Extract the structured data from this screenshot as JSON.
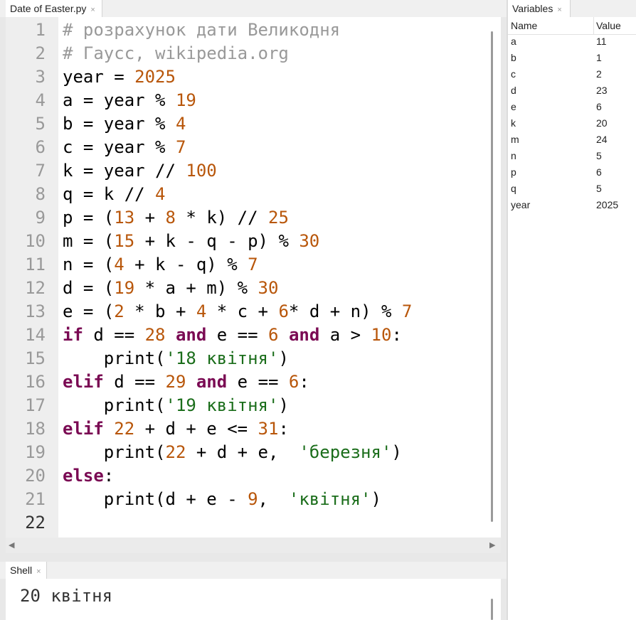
{
  "editor": {
    "tab_label": "Date of Easter.py",
    "tab_close": "×",
    "line_numbers": [
      "1",
      "2",
      "3",
      "4",
      "5",
      "6",
      "7",
      "8",
      "9",
      "10",
      "11",
      "12",
      "13",
      "14",
      "15",
      "16",
      "17",
      "18",
      "19",
      "20",
      "21",
      "22"
    ],
    "lines": [
      [
        {
          "t": "# розрахунок дати Великодня",
          "c": "cm"
        }
      ],
      [
        {
          "t": "# Гаусс, wikipedia.org",
          "c": "cm"
        }
      ],
      [
        {
          "t": "year = ",
          "c": ""
        },
        {
          "t": "2025",
          "c": "nm"
        }
      ],
      [
        {
          "t": "a = year % ",
          "c": ""
        },
        {
          "t": "19",
          "c": "nm"
        }
      ],
      [
        {
          "t": "b = year % ",
          "c": ""
        },
        {
          "t": "4",
          "c": "nm"
        }
      ],
      [
        {
          "t": "c = year % ",
          "c": ""
        },
        {
          "t": "7",
          "c": "nm"
        }
      ],
      [
        {
          "t": "k = year // ",
          "c": ""
        },
        {
          "t": "100",
          "c": "nm"
        }
      ],
      [
        {
          "t": "q = k // ",
          "c": ""
        },
        {
          "t": "4",
          "c": "nm"
        }
      ],
      [
        {
          "t": "p = (",
          "c": ""
        },
        {
          "t": "13",
          "c": "nm"
        },
        {
          "t": " + ",
          "c": ""
        },
        {
          "t": "8",
          "c": "nm"
        },
        {
          "t": " * k) // ",
          "c": ""
        },
        {
          "t": "25",
          "c": "nm"
        }
      ],
      [
        {
          "t": "m = (",
          "c": ""
        },
        {
          "t": "15",
          "c": "nm"
        },
        {
          "t": " + k - q - p) % ",
          "c": ""
        },
        {
          "t": "30",
          "c": "nm"
        }
      ],
      [
        {
          "t": "n = (",
          "c": ""
        },
        {
          "t": "4",
          "c": "nm"
        },
        {
          "t": " + k - q) % ",
          "c": ""
        },
        {
          "t": "7",
          "c": "nm"
        }
      ],
      [
        {
          "t": "d = (",
          "c": ""
        },
        {
          "t": "19",
          "c": "nm"
        },
        {
          "t": " * a + m) % ",
          "c": ""
        },
        {
          "t": "30",
          "c": "nm"
        }
      ],
      [
        {
          "t": "e = (",
          "c": ""
        },
        {
          "t": "2",
          "c": "nm"
        },
        {
          "t": " * b + ",
          "c": ""
        },
        {
          "t": "4",
          "c": "nm"
        },
        {
          "t": " * c + ",
          "c": ""
        },
        {
          "t": "6",
          "c": "nm"
        },
        {
          "t": "* d + n) % ",
          "c": ""
        },
        {
          "t": "7",
          "c": "nm"
        }
      ],
      [
        {
          "t": "if",
          "c": "kw"
        },
        {
          "t": " d == ",
          "c": ""
        },
        {
          "t": "28",
          "c": "nm"
        },
        {
          "t": " ",
          "c": ""
        },
        {
          "t": "and",
          "c": "kw"
        },
        {
          "t": " e == ",
          "c": ""
        },
        {
          "t": "6",
          "c": "nm"
        },
        {
          "t": " ",
          "c": ""
        },
        {
          "t": "and",
          "c": "kw"
        },
        {
          "t": " a > ",
          "c": ""
        },
        {
          "t": "10",
          "c": "nm"
        },
        {
          "t": ":",
          "c": ""
        }
      ],
      [
        {
          "t": "    print(",
          "c": ""
        },
        {
          "t": "'18 квітня'",
          "c": "st"
        },
        {
          "t": ")",
          "c": ""
        }
      ],
      [
        {
          "t": "elif",
          "c": "kw"
        },
        {
          "t": " d == ",
          "c": ""
        },
        {
          "t": "29",
          "c": "nm"
        },
        {
          "t": " ",
          "c": ""
        },
        {
          "t": "and",
          "c": "kw"
        },
        {
          "t": " e == ",
          "c": ""
        },
        {
          "t": "6",
          "c": "nm"
        },
        {
          "t": ":",
          "c": ""
        }
      ],
      [
        {
          "t": "    print(",
          "c": ""
        },
        {
          "t": "'19 квітня'",
          "c": "st"
        },
        {
          "t": ")",
          "c": ""
        }
      ],
      [
        {
          "t": "elif",
          "c": "kw"
        },
        {
          "t": " ",
          "c": ""
        },
        {
          "t": "22",
          "c": "nm"
        },
        {
          "t": " + d + e <= ",
          "c": ""
        },
        {
          "t": "31",
          "c": "nm"
        },
        {
          "t": ":",
          "c": ""
        }
      ],
      [
        {
          "t": "    print(",
          "c": ""
        },
        {
          "t": "22",
          "c": "nm"
        },
        {
          "t": " + d + e,  ",
          "c": ""
        },
        {
          "t": "'березня'",
          "c": "st"
        },
        {
          "t": ")",
          "c": ""
        }
      ],
      [
        {
          "t": "else",
          "c": "kw"
        },
        {
          "t": ":",
          "c": ""
        }
      ],
      [
        {
          "t": "    print(d + e - ",
          "c": ""
        },
        {
          "t": "9",
          "c": "nm"
        },
        {
          "t": ",  ",
          "c": ""
        },
        {
          "t": "'квітня'",
          "c": "st"
        },
        {
          "t": ")",
          "c": ""
        }
      ],
      []
    ],
    "current_line": 22
  },
  "shell": {
    "tab_label": "Shell",
    "tab_close": "×",
    "output": "20 квітня"
  },
  "variables": {
    "tab_label": "Variables",
    "tab_close": "×",
    "col_name": "Name",
    "col_value": "Value",
    "rows": [
      {
        "name": "a",
        "value": "11"
      },
      {
        "name": "b",
        "value": "1"
      },
      {
        "name": "c",
        "value": "2"
      },
      {
        "name": "d",
        "value": "23"
      },
      {
        "name": "e",
        "value": "6"
      },
      {
        "name": "k",
        "value": "20"
      },
      {
        "name": "m",
        "value": "24"
      },
      {
        "name": "n",
        "value": "5"
      },
      {
        "name": "p",
        "value": "6"
      },
      {
        "name": "q",
        "value": "5"
      },
      {
        "name": "year",
        "value": "2025"
      }
    ]
  },
  "icons": {
    "scroll_left": "scroll-left-icon",
    "scroll_right": "scroll-right-icon"
  }
}
